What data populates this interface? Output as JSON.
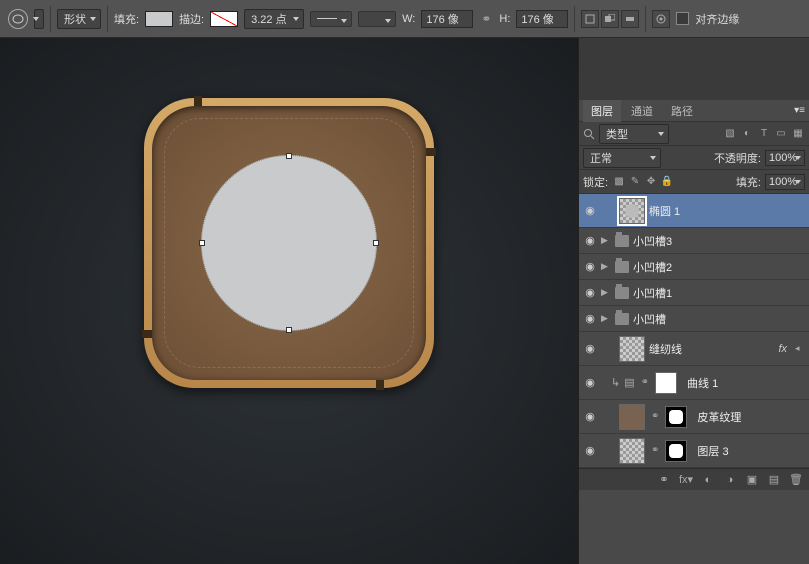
{
  "toolbar": {
    "tool_icon": "ellipse-tool-icon",
    "mode_label": "形状",
    "fill_label": "填充:",
    "fill_swatch": "#c8cacc",
    "stroke_label": "描边:",
    "stroke_swatch_none": true,
    "stroke_weight": "3.22 点",
    "w_label": "W:",
    "w_value": "176 像",
    "h_label": "H:",
    "h_value": "176 像",
    "align_edges_label": "对齐边缘",
    "align_edges_checked": false
  },
  "canvas": {
    "shape": "椭圆 1",
    "shape_w": 176,
    "shape_h": 176,
    "shape_fill": "#c8cacc"
  },
  "panel": {
    "tabs": {
      "layers": "图层",
      "channels": "通道",
      "paths": "路径"
    },
    "filter_type_label": "类型",
    "blend_mode": "正常",
    "opacity_label": "不透明度:",
    "opacity_value": "100%",
    "lock_label": "锁定:",
    "fill_opacity_label": "填充:",
    "fill_opacity_value": "100%",
    "layers": [
      {
        "name": "椭圆 1",
        "kind": "shape",
        "selected": true
      },
      {
        "name": "小凹槽3",
        "kind": "group"
      },
      {
        "name": "小凹槽2",
        "kind": "group"
      },
      {
        "name": "小凹槽1",
        "kind": "group"
      },
      {
        "name": "小凹槽",
        "kind": "group"
      },
      {
        "name": "缝纫线",
        "kind": "shape",
        "fx": true
      },
      {
        "name": "曲线 1",
        "kind": "adjustment"
      },
      {
        "name": "皮革纹理",
        "kind": "raster_masked"
      },
      {
        "name": "图层 3",
        "kind": "raster_masked2"
      }
    ]
  }
}
